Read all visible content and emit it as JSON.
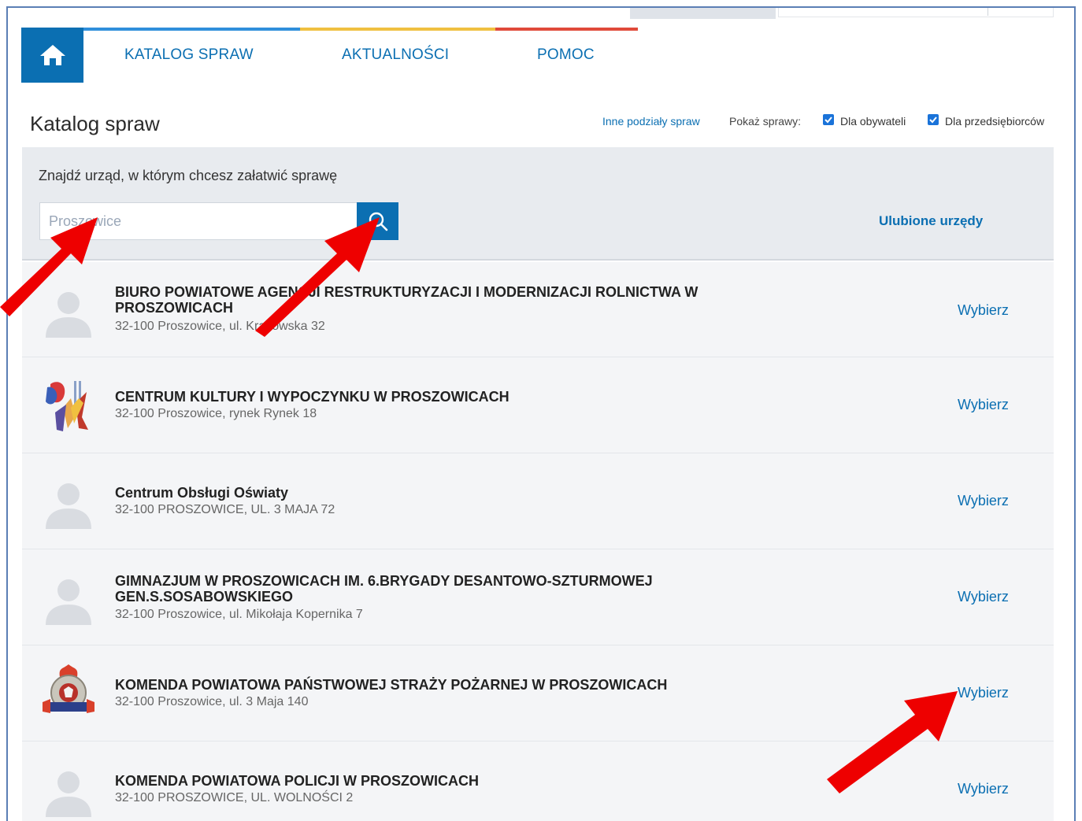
{
  "nav": {
    "items": [
      {
        "label": "KATALOG SPRAW"
      },
      {
        "label": "AKTUALNOŚCI"
      },
      {
        "label": "POMOC"
      }
    ],
    "stripe_colors": [
      "#2f8fdb",
      "#f0c040",
      "#e04a3a"
    ]
  },
  "header": {
    "title": "Katalog spraw",
    "other_link": "Inne podziały spraw",
    "show_label": "Pokaż sprawy:",
    "filters": [
      {
        "label": "Dla obywateli",
        "checked": true
      },
      {
        "label": "Dla przedsiębiorców",
        "checked": true
      }
    ]
  },
  "search": {
    "hint": "Znajdź urząd, w którym chcesz załatwić sprawę",
    "value": "Proszowice",
    "favorites_link": "Ulubione urzędy"
  },
  "offices": [
    {
      "name": "BIURO POWIATOWE AGENCJI RESTRUKTURYZACJI I MODERNIZACJI ROLNICTWA W PROSZOWICACH",
      "address": "32-100 Proszowice, ul. Krakowska 32",
      "icon": "person-placeholder-icon",
      "action": "Wybierz"
    },
    {
      "name": "CENTRUM KULTURY I WYPOCZYNKU W PROSZOWICACH",
      "address": "32-100 Proszowice, rynek Rynek 18",
      "icon": "culture-center-logo",
      "action": "Wybierz"
    },
    {
      "name": "Centrum Obsługi Oświaty",
      "address": "32-100 PROSZOWICE, UL. 3 MAJA 72",
      "icon": "person-placeholder-icon",
      "action": "Wybierz"
    },
    {
      "name": "GIMNAZJUM W PROSZOWICACH IM. 6.BRYGADY DESANTOWO-SZTURMOWEJ GEN.S.SOSABOWSKIEGO",
      "address": "32-100 Proszowice, ul. Mikołaja Kopernika 7",
      "icon": "person-placeholder-icon",
      "action": "Wybierz"
    },
    {
      "name": "KOMENDA POWIATOWA PAŃSTWOWEJ STRAŻY POŻARNEJ W PROSZOWICACH",
      "address": "32-100 Proszowice, ul. 3 Maja 140",
      "icon": "fire-brigade-emblem",
      "action": "Wybierz"
    },
    {
      "name": "KOMENDA POWIATOWA POLICJI W PROSZOWICACH",
      "address": "32-100 PROSZOWICE, UL. WOLNOŚCI 2",
      "icon": "person-placeholder-icon",
      "action": "Wybierz"
    }
  ],
  "colors": {
    "accent": "#0b6fb2",
    "annotation_arrow": "#ee0000"
  }
}
